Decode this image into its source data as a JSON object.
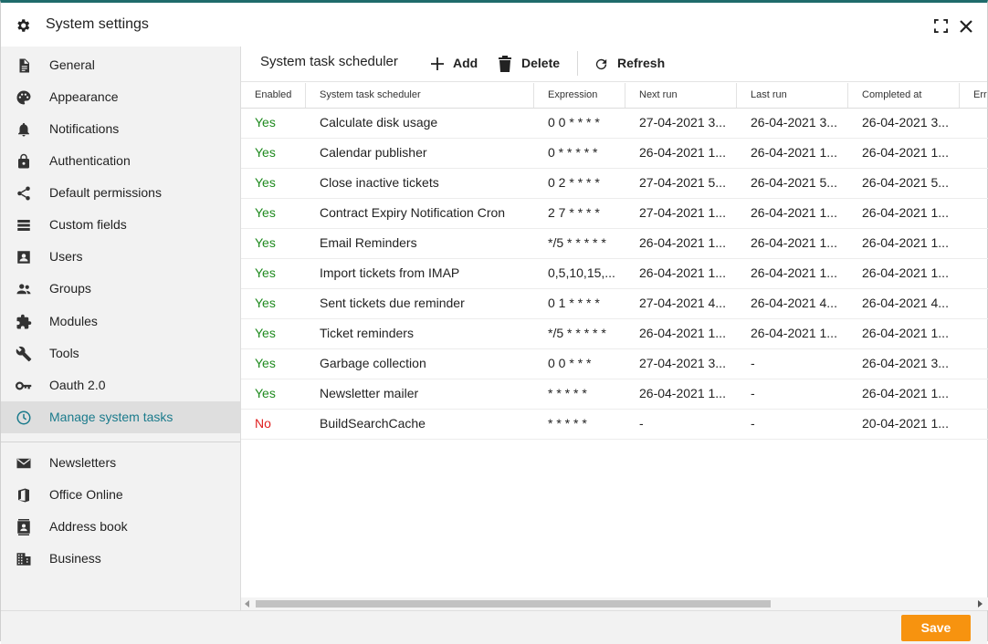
{
  "window": {
    "title": "System settings"
  },
  "sidebar": {
    "items": [
      {
        "label": "General",
        "icon": "document-icon"
      },
      {
        "label": "Appearance",
        "icon": "palette-icon"
      },
      {
        "label": "Notifications",
        "icon": "bell-icon"
      },
      {
        "label": "Authentication",
        "icon": "lock-icon"
      },
      {
        "label": "Default permissions",
        "icon": "share-icon"
      },
      {
        "label": "Custom fields",
        "icon": "list-icon"
      },
      {
        "label": "Users",
        "icon": "user-icon"
      },
      {
        "label": "Groups",
        "icon": "groups-icon"
      },
      {
        "label": "Modules",
        "icon": "puzzle-icon"
      },
      {
        "label": "Tools",
        "icon": "wrench-icon"
      },
      {
        "label": "Oauth 2.0",
        "icon": "key-icon"
      },
      {
        "label": "Manage system tasks",
        "icon": "clock-icon",
        "active": true
      }
    ],
    "items2": [
      {
        "label": "Newsletters",
        "icon": "envelope-icon"
      },
      {
        "label": "Office Online",
        "icon": "office-icon"
      },
      {
        "label": "Address book",
        "icon": "address-book-icon"
      },
      {
        "label": "Business",
        "icon": "building-icon"
      }
    ]
  },
  "toolbar": {
    "title": "System task scheduler",
    "add_label": "Add",
    "delete_label": "Delete",
    "refresh_label": "Refresh"
  },
  "table": {
    "columns": [
      "Enabled",
      "System task scheduler",
      "Expression",
      "Next run",
      "Last run",
      "Completed at",
      "Err"
    ],
    "rows": [
      [
        "Yes",
        "Calculate disk usage",
        "0 0 * * * *",
        "27-04-2021 3...",
        "26-04-2021 3...",
        "26-04-2021 3..."
      ],
      [
        "Yes",
        "Calendar publisher",
        "0 * * * * *",
        "26-04-2021 1...",
        "26-04-2021 1...",
        "26-04-2021 1..."
      ],
      [
        "Yes",
        "Close inactive tickets",
        "0 2 * * * *",
        "27-04-2021 5...",
        "26-04-2021 5...",
        "26-04-2021 5..."
      ],
      [
        "Yes",
        "Contract Expiry Notification Cron",
        "2 7 * * * *",
        "27-04-2021 1...",
        "26-04-2021 1...",
        "26-04-2021 1..."
      ],
      [
        "Yes",
        "Email Reminders",
        "*/5 * * * * *",
        "26-04-2021 1...",
        "26-04-2021 1...",
        "26-04-2021 1..."
      ],
      [
        "Yes",
        "Import tickets from IMAP",
        "0,5,10,15,...",
        "26-04-2021 1...",
        "26-04-2021 1...",
        "26-04-2021 1..."
      ],
      [
        "Yes",
        "Sent tickets due reminder",
        "0 1 * * * *",
        "27-04-2021 4...",
        "26-04-2021 4...",
        "26-04-2021 4..."
      ],
      [
        "Yes",
        "Ticket reminders",
        "*/5 * * * * *",
        "26-04-2021 1...",
        "26-04-2021 1...",
        "26-04-2021 1..."
      ],
      [
        "Yes",
        "Garbage collection",
        "0 0 * * *",
        "27-04-2021 3...",
        "-",
        "26-04-2021 3..."
      ],
      [
        "Yes",
        "Newsletter mailer",
        "* * * * *",
        "26-04-2021 1...",
        "-",
        "26-04-2021 1..."
      ],
      [
        "No",
        "BuildSearchCache",
        "* * * * *",
        "-",
        "-",
        "20-04-2021 1..."
      ]
    ]
  },
  "footer": {
    "save_label": "Save"
  },
  "colors": {
    "accent": "#1b7b8c",
    "save": "#f7930f",
    "yes": "#1e8a1e",
    "no": "#e02020"
  }
}
